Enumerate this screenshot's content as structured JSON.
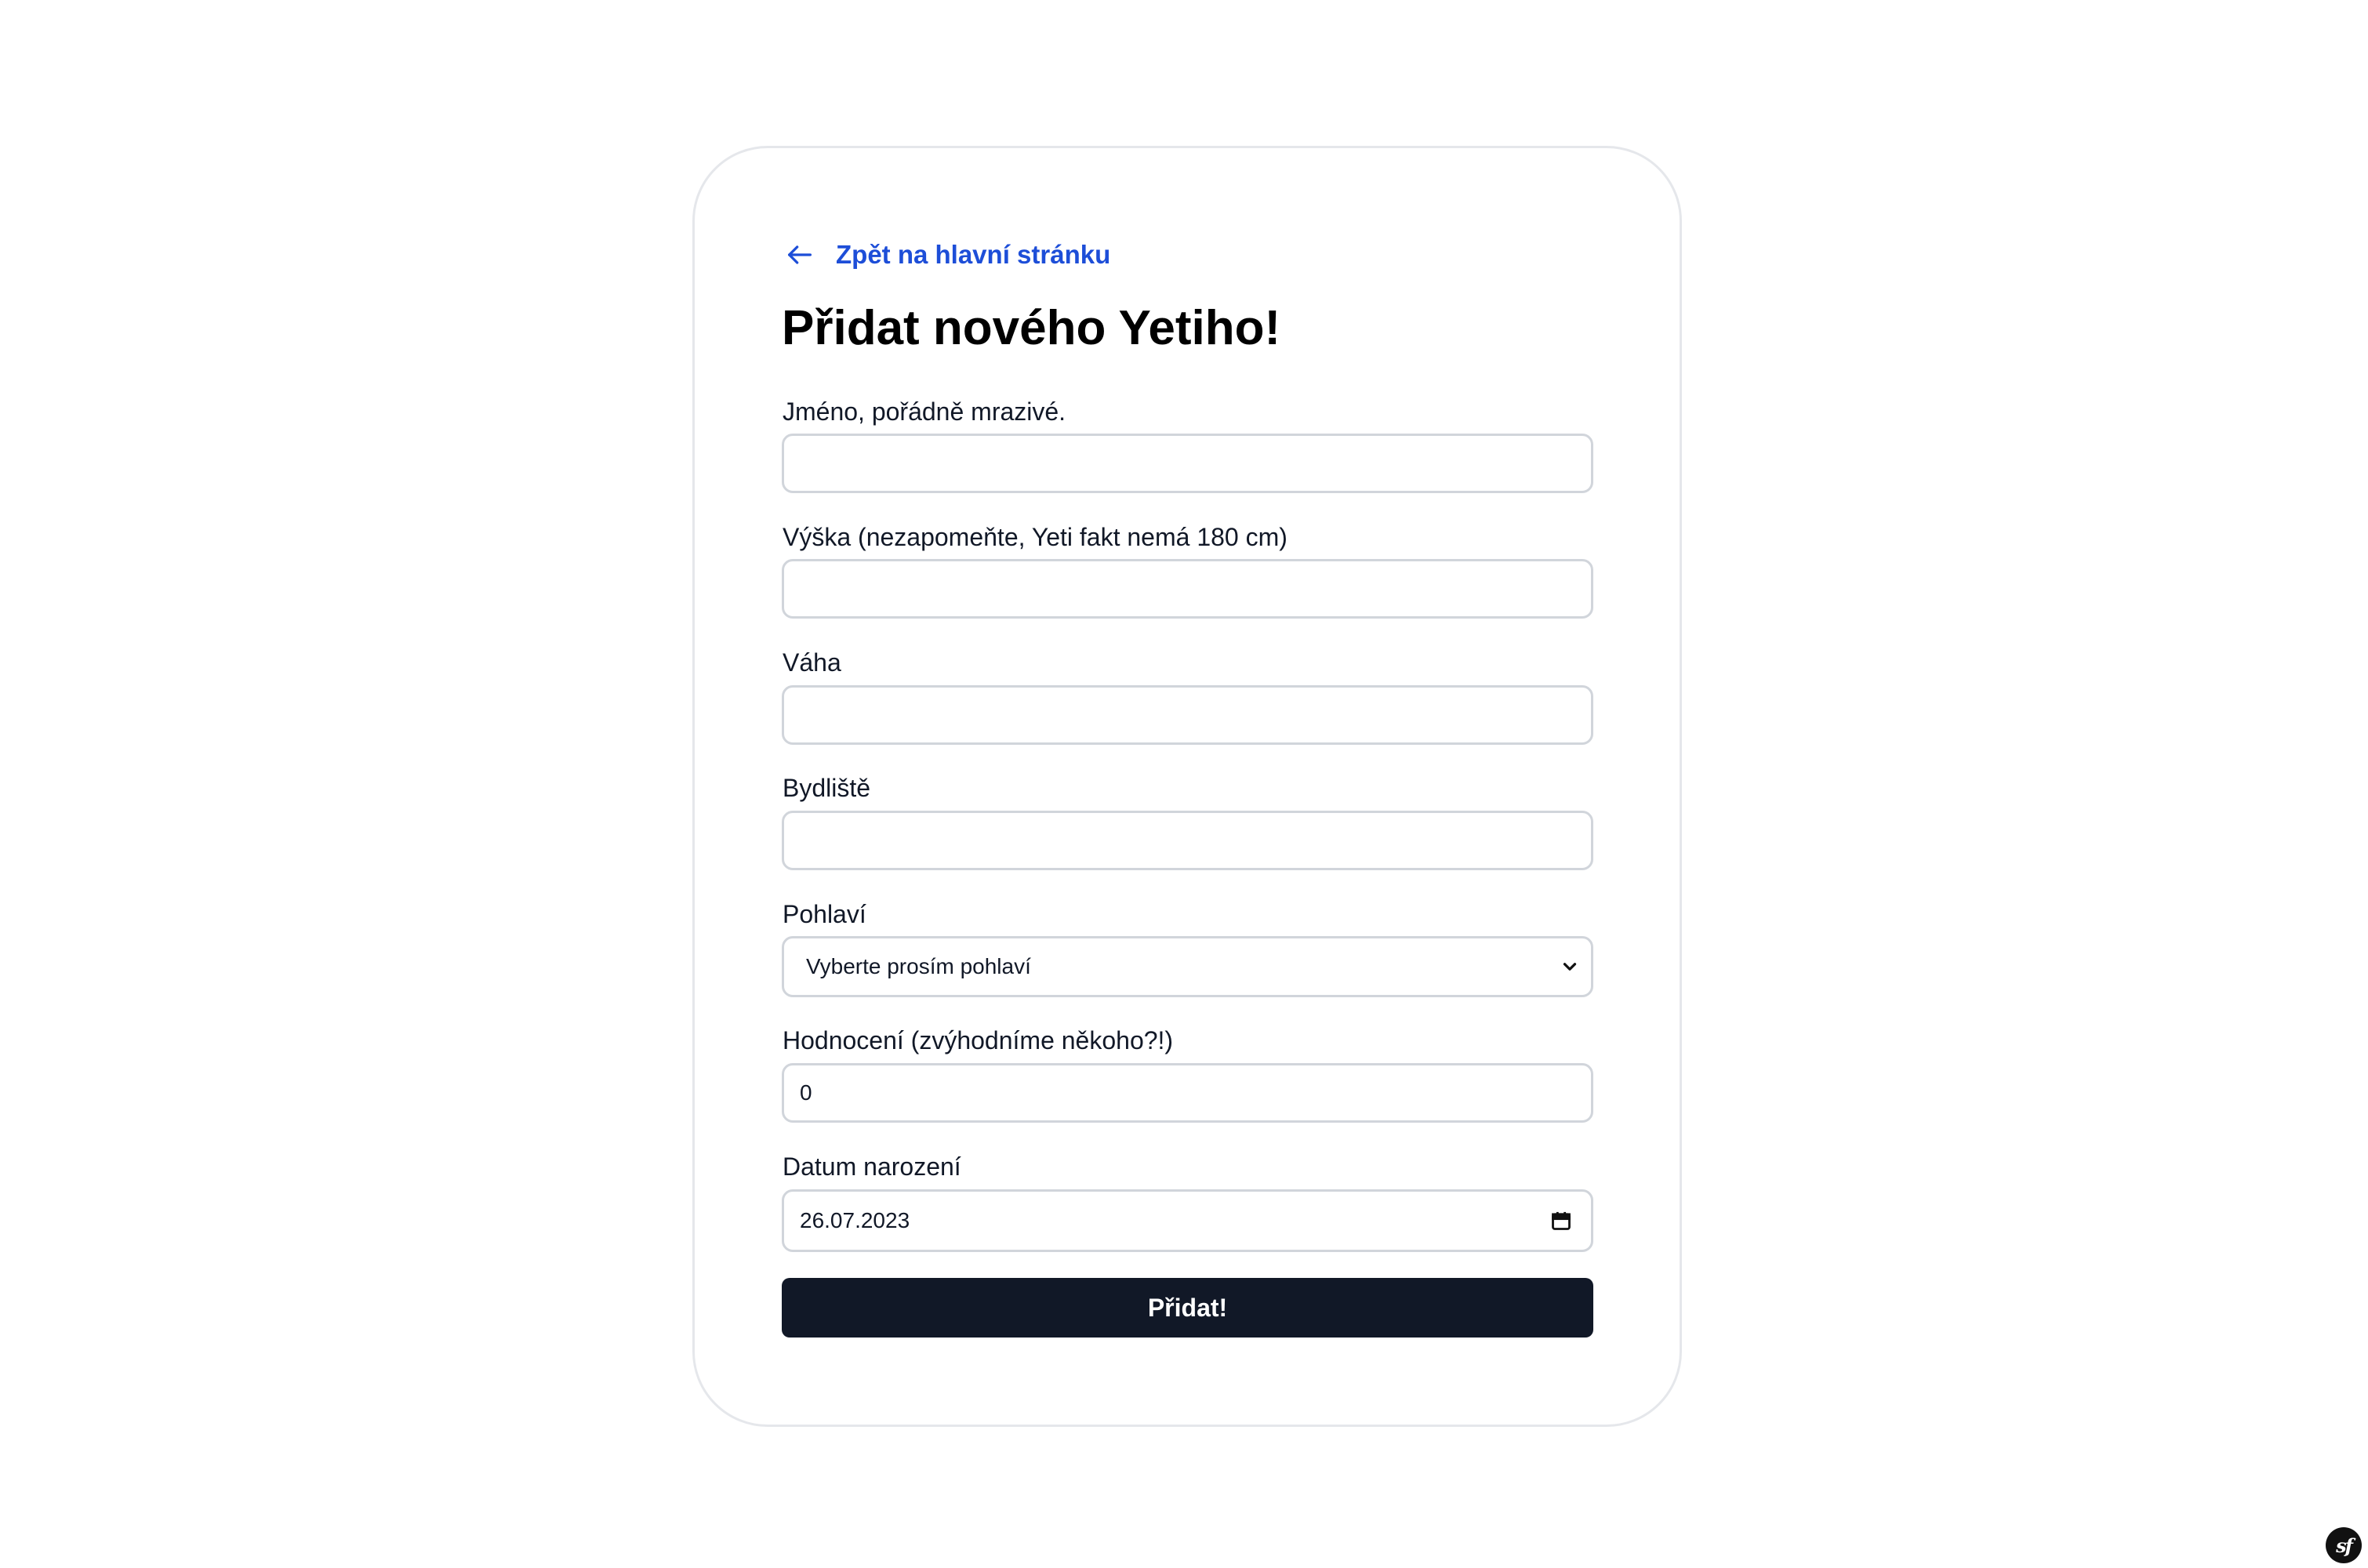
{
  "back_link": {
    "label": "Zpět na hlavní stránku",
    "icon": "arrow-left-icon"
  },
  "title": "Přidat nového Yetiho!",
  "form": {
    "name": {
      "label": "Jméno, pořádně mrazivé.",
      "value": ""
    },
    "height": {
      "label": "Výška (nezapomeňte, Yeti fakt nemá 180 cm)",
      "value": ""
    },
    "weight": {
      "label": "Váha",
      "value": ""
    },
    "residence": {
      "label": "Bydliště",
      "value": ""
    },
    "gender": {
      "label": "Pohlaví",
      "selected": "Vyberte prosím pohlaví",
      "icon": "chevron-down-icon"
    },
    "rating": {
      "label": "Hodnocení (zvýhodníme někoho?!)",
      "value": "0"
    },
    "birthdate": {
      "label": "Datum narození",
      "value": "26.07.2023",
      "icon": "calendar-icon"
    },
    "submit_label": "Přidat!"
  },
  "debug_toolbar": {
    "label": "sf",
    "icon": "symfony-logo-icon"
  },
  "colors": {
    "link": "#1d4ed8",
    "button_bg": "#111827",
    "border": "#d1d5db",
    "card_border": "#e5e7eb"
  }
}
